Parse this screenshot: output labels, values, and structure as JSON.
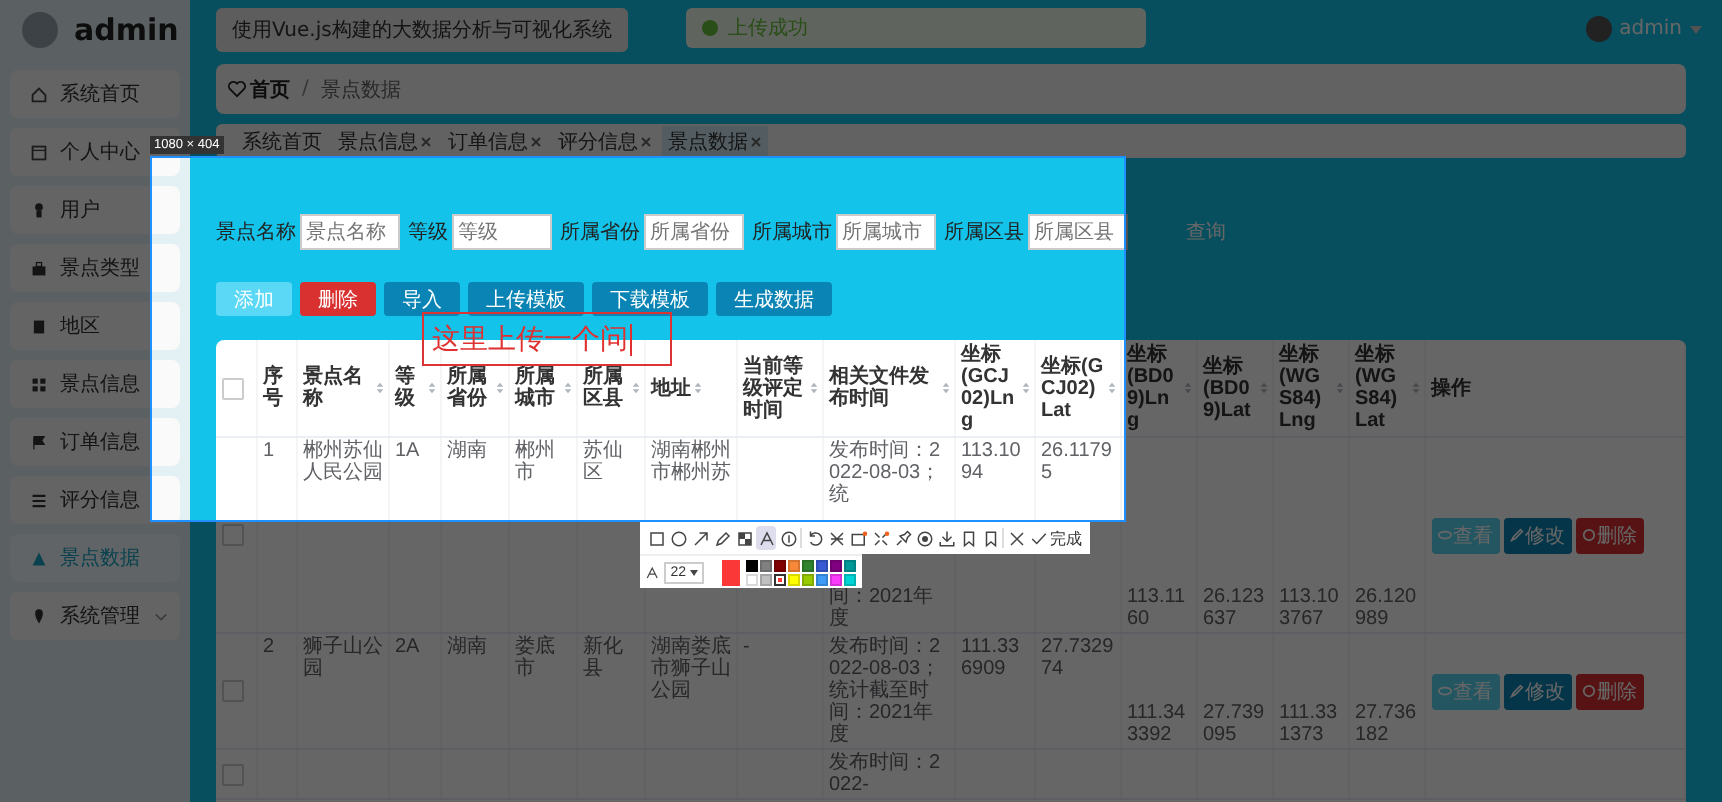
{
  "sidebar": {
    "user": "admin",
    "items": [
      {
        "label": "系统首页",
        "selected": false,
        "expandable": false
      },
      {
        "label": "个人中心",
        "selected": false,
        "expandable": false
      },
      {
        "label": "用户",
        "selected": false,
        "expandable": false
      },
      {
        "label": "景点类型",
        "selected": false,
        "expandable": false
      },
      {
        "label": "地区",
        "selected": false,
        "expandable": false
      },
      {
        "label": "景点信息",
        "selected": false,
        "expandable": false
      },
      {
        "label": "订单信息",
        "selected": false,
        "expandable": false
      },
      {
        "label": "评分信息",
        "selected": false,
        "expandable": false
      },
      {
        "label": "景点数据",
        "selected": true,
        "expandable": false
      },
      {
        "label": "系统管理",
        "selected": false,
        "expandable": true
      }
    ]
  },
  "header": {
    "title": "使用Vue.js构建的大数据分析与可视化系统",
    "user": "admin"
  },
  "toast": {
    "message": "上传成功"
  },
  "breadcrumb": {
    "home": "首页",
    "separator": "/",
    "current": "景点数据"
  },
  "tabs": [
    {
      "label": "系统首页",
      "closable": false,
      "selected": false
    },
    {
      "label": "景点信息",
      "closable": true,
      "selected": false
    },
    {
      "label": "订单信息",
      "closable": true,
      "selected": false
    },
    {
      "label": "评分信息",
      "closable": true,
      "selected": false
    },
    {
      "label": "景点数据",
      "closable": true,
      "selected": true
    }
  ],
  "search": {
    "fields": [
      {
        "label": "景点名称",
        "placeholder": "景点名称"
      },
      {
        "label": "等级",
        "placeholder": "等级"
      },
      {
        "label": "所属省份",
        "placeholder": "所属省份"
      },
      {
        "label": "所属城市",
        "placeholder": "所属城市"
      },
      {
        "label": "所属区县",
        "placeholder": "所属区县"
      }
    ],
    "button": "查询"
  },
  "actions": [
    {
      "label": "添加",
      "kind": "light"
    },
    {
      "label": "删除",
      "kind": "danger"
    },
    {
      "label": "导入",
      "kind": "primary"
    },
    {
      "label": "上传模板",
      "kind": "primary"
    },
    {
      "label": "下载模板",
      "kind": "primary"
    },
    {
      "label": "生成数据",
      "kind": "primary"
    }
  ],
  "table": {
    "select_all": {
      "checked": false
    },
    "columns": [
      {
        "label": "序号",
        "sortable": false
      },
      {
        "label": "景点名称",
        "sortable": true
      },
      {
        "label": "等级",
        "sortable": true
      },
      {
        "label": "所属省份",
        "sortable": true
      },
      {
        "label": "所属城市",
        "sortable": true
      },
      {
        "label": "所属区县",
        "sortable": true
      },
      {
        "label": "地址",
        "sortable": true
      },
      {
        "label": "当前等级评定时间",
        "sortable": true
      },
      {
        "label": "相关文件发布时间",
        "sortable": true
      },
      {
        "label": "坐标(GCJ02)Lng",
        "sortable": true
      },
      {
        "label": "坐标(GCJ02)Lat",
        "sortable": true
      },
      {
        "label": "坐标(BD09)Lng",
        "sortable": true
      },
      {
        "label": "坐标(BD09)Lat",
        "sortable": true
      },
      {
        "label": "坐标(WGS84)Lng",
        "sortable": true
      },
      {
        "label": "坐标(WGS84)Lat",
        "sortable": true
      },
      {
        "label": "操作",
        "sortable": false
      }
    ],
    "rows": [
      {
        "checked": false,
        "cells": [
          "1",
          "郴州苏仙人民公园",
          "1A",
          "湖南",
          "郴州市",
          "苏仙区",
          "湖南郴州市郴州苏",
          null,
          [
            "发布时间：2022-08-03；统",
            "间：2021年度"
          ],
          "113.1094",
          "26.11795",
          "113.1160",
          "26.123637",
          "113.103767",
          "26.120989"
        ],
        "buttons": [
          {
            "label": "查看",
            "kind": "view"
          },
          {
            "label": "修改",
            "kind": "edit"
          },
          {
            "label": "删除",
            "kind": "delete"
          }
        ]
      },
      {
        "checked": false,
        "cells": [
          "2",
          "狮子山公园",
          "2A",
          "湖南",
          "娄底市",
          "新化县",
          "湖南娄底市狮子山公园",
          "-",
          "发布时间：2022-08-03；统计截至时间：2021年度",
          "111.336909",
          "27.732974",
          "111.343392",
          "27.739095",
          "111.331373",
          "27.736182"
        ],
        "buttons": [
          {
            "label": "查看",
            "kind": "view"
          },
          {
            "label": "修改",
            "kind": "edit"
          },
          {
            "label": "删除",
            "kind": "delete"
          }
        ]
      },
      {
        "checked": false,
        "cells": [
          null,
          null,
          null,
          null,
          null,
          null,
          null,
          null,
          "发布时间：2022-",
          null,
          null,
          null,
          null,
          null,
          null
        ],
        "buttons": []
      }
    ]
  },
  "capture": {
    "size_label": "1080 × 404",
    "annotation": "这里上传一个问",
    "tools": [
      {
        "kind": "rect",
        "selected": false
      },
      {
        "kind": "ellipse",
        "selected": false
      },
      {
        "kind": "arrow",
        "selected": false
      },
      {
        "kind": "pencil",
        "selected": false
      },
      {
        "kind": "mosaic",
        "selected": false
      },
      {
        "kind": "text",
        "selected": true
      },
      {
        "kind": "number",
        "selected": false
      },
      {
        "kind": "undo",
        "selected": false
      },
      {
        "kind": "crop",
        "selected": false
      },
      {
        "kind": "image",
        "selected": false
      },
      {
        "kind": "expand",
        "selected": false
      },
      {
        "kind": "pin",
        "selected": false
      },
      {
        "kind": "record",
        "selected": false
      },
      {
        "kind": "download",
        "selected": false
      },
      {
        "kind": "bookmark",
        "selected": false
      },
      {
        "kind": "bookmark",
        "selected": false
      },
      {
        "kind": "close",
        "selected": false
      },
      {
        "kind": "done",
        "label": "完成",
        "selected": false
      }
    ],
    "font_size": "22",
    "palette": [
      {
        "color": "#000000",
        "selected": false
      },
      {
        "color": "#808080",
        "selected": false
      },
      {
        "color": "#800000",
        "selected": false
      },
      {
        "color": "#f7883a",
        "selected": false
      },
      {
        "color": "#308430",
        "selected": false
      },
      {
        "color": "#385ad3",
        "selected": false
      },
      {
        "color": "#800080",
        "selected": false
      },
      {
        "color": "#009999",
        "selected": false
      },
      {
        "color": "#ffffff",
        "selected": false
      },
      {
        "color": "#c0c0c0",
        "selected": false
      },
      {
        "color": "#fb3838",
        "selected": true
      },
      {
        "color": "#ffff00",
        "selected": false
      },
      {
        "color": "#99cc00",
        "selected": false
      },
      {
        "color": "#3d9af5",
        "selected": false
      },
      {
        "color": "#fb3bfb",
        "selected": false
      },
      {
        "color": "#00d4d4",
        "selected": false
      }
    ]
  }
}
